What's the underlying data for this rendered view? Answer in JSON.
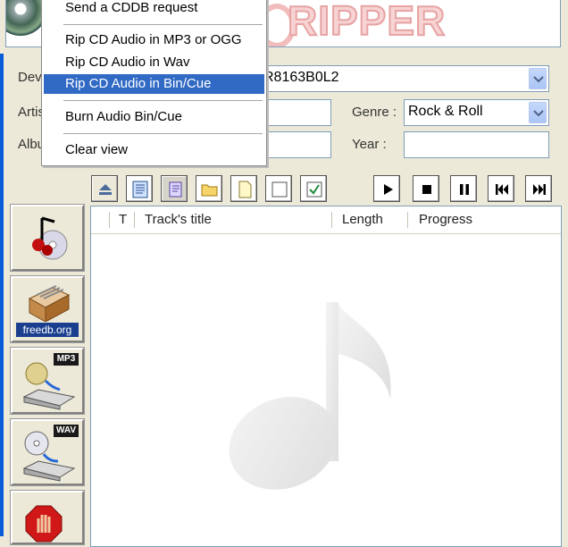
{
  "banner": {
    "brand_text": "RIPPER",
    "brand_color": "#f7d3d3"
  },
  "form": {
    "device_label": "Dev",
    "device_value": "R8163B0L2",
    "artist_label": "Artis",
    "album_label": "Albu",
    "genre_label": "Genre :",
    "genre_value": "Rock & Roll",
    "year_label": "Year :"
  },
  "toolbar": {
    "left_icons": [
      "eject-icon",
      "cd-text-icon",
      "copy-icon",
      "folder-icon",
      "new-file-icon",
      "uncheck-all-icon",
      "check-all-icon"
    ],
    "right_icons": [
      "play-icon",
      "stop-icon",
      "pause-icon",
      "previous-track-icon",
      "next-track-icon"
    ]
  },
  "sidebar": {
    "buttons": [
      {
        "name": "cd-music-icon"
      },
      {
        "name": "freedb-icon",
        "caption": "freedb.org"
      },
      {
        "name": "rip-mp3-icon",
        "badge": "MP3"
      },
      {
        "name": "rip-wav-icon",
        "badge": "WAV"
      },
      {
        "name": "stop-hand-icon"
      }
    ]
  },
  "tracklist": {
    "columns": [
      "T",
      "Track's title",
      "Length",
      "Progress"
    ],
    "watermark_icon": "music-note-icon"
  },
  "context_menu": {
    "items": [
      {
        "label": "Send a CDDB request",
        "selected": false
      },
      {
        "label": "Rip CD Audio in MP3 or OGG",
        "selected": false
      },
      {
        "label": "Rip CD Audio in Wav",
        "selected": false
      },
      {
        "label": "Rip CD Audio in Bin/Cue",
        "selected": true
      },
      {
        "label": "Burn Audio Bin/Cue",
        "selected": false
      },
      {
        "label": "Clear view",
        "selected": false
      }
    ],
    "highlight_color": "#316ac5"
  }
}
